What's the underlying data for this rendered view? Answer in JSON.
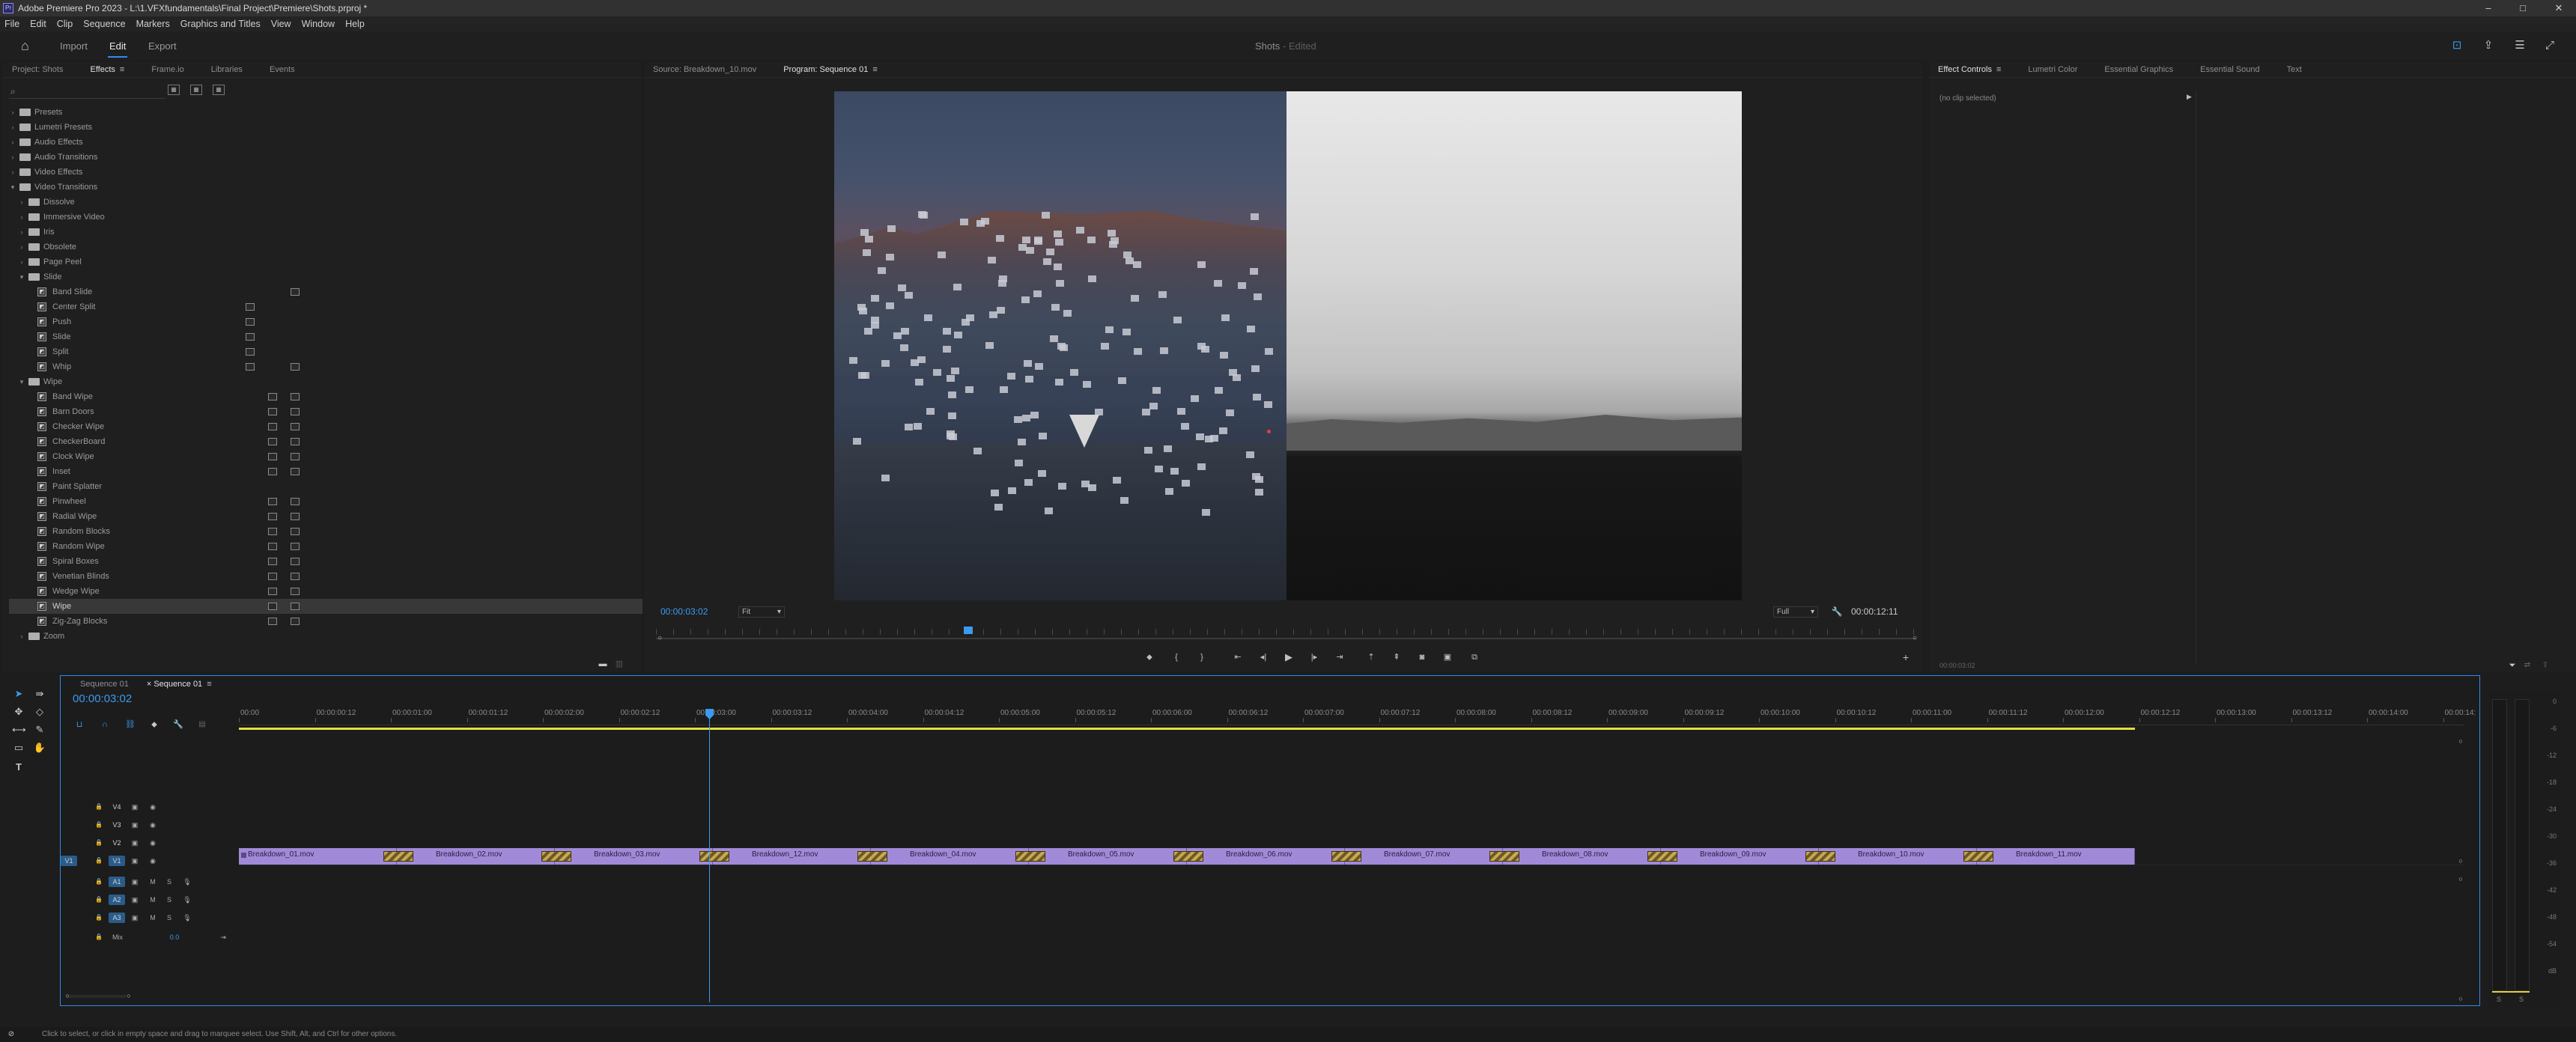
{
  "window": {
    "title": "Adobe Premiere Pro 2023 - L:\\1.VFXfundamentals\\Final Project\\Premiere\\Shots.prproj *",
    "minimize": "–",
    "maximize": "□",
    "close": "✕"
  },
  "menu": [
    "File",
    "Edit",
    "Clip",
    "Sequence",
    "Markers",
    "Graphics and Titles",
    "View",
    "Window",
    "Help"
  ],
  "workspace": {
    "tabs": [
      "Import",
      "Edit",
      "Export"
    ],
    "active_tab": "Edit",
    "project_name": "Shots",
    "project_status": "Edited",
    "icons": [
      "home-icon",
      "workspaces-icon",
      "share-icon",
      "panels-icon",
      "resize-icon"
    ]
  },
  "project_panel": {
    "tabs": [
      "Project: Shots",
      "Effects",
      "Frame.io",
      "Libraries",
      "Events"
    ],
    "active_tab": "Effects",
    "tab_menu": "≡",
    "search_icon": "⌕",
    "tree": [
      {
        "level": 0,
        "kind": "folder",
        "label": "Presets",
        "open": false
      },
      {
        "level": 0,
        "kind": "folder",
        "label": "Lumetri Presets",
        "open": false
      },
      {
        "level": 0,
        "kind": "folder",
        "label": "Audio Effects",
        "open": false
      },
      {
        "level": 0,
        "kind": "folder",
        "label": "Audio Transitions",
        "open": false
      },
      {
        "level": 0,
        "kind": "folder",
        "label": "Video Effects",
        "open": false
      },
      {
        "level": 0,
        "kind": "folder",
        "label": "Video Transitions",
        "open": true
      },
      {
        "level": 1,
        "kind": "folder",
        "label": "Dissolve",
        "open": false
      },
      {
        "level": 1,
        "kind": "folder",
        "label": "Immersive Video",
        "open": false
      },
      {
        "level": 1,
        "kind": "folder",
        "label": "Iris",
        "open": false
      },
      {
        "level": 1,
        "kind": "folder",
        "label": "Obsolete",
        "open": false
      },
      {
        "level": 1,
        "kind": "folder",
        "label": "Page Peel",
        "open": false
      },
      {
        "level": 1,
        "kind": "folder",
        "label": "Slide",
        "open": true
      },
      {
        "level": 2,
        "kind": "fx",
        "label": "Band Slide",
        "b1": false,
        "b2": true
      },
      {
        "level": 2,
        "kind": "fx",
        "label": "Center Split",
        "b1": true,
        "b2": false
      },
      {
        "level": 2,
        "kind": "fx",
        "label": "Push",
        "b1": true,
        "b2": false
      },
      {
        "level": 2,
        "kind": "fx",
        "label": "Slide",
        "b1": true,
        "b2": false
      },
      {
        "level": 2,
        "kind": "fx",
        "label": "Split",
        "b1": true,
        "b2": false
      },
      {
        "level": 2,
        "kind": "fx",
        "label": "Whip",
        "b1": true,
        "b2": true
      },
      {
        "level": 1,
        "kind": "folder",
        "label": "Wipe",
        "open": true
      },
      {
        "level": 2,
        "kind": "fx",
        "label": "Band Wipe",
        "b1": true,
        "b2": true
      },
      {
        "level": 2,
        "kind": "fx",
        "label": "Barn Doors",
        "b1": true,
        "b2": true
      },
      {
        "level": 2,
        "kind": "fx",
        "label": "Checker Wipe",
        "b1": true,
        "b2": true
      },
      {
        "level": 2,
        "kind": "fx",
        "label": "CheckerBoard",
        "b1": true,
        "b2": true
      },
      {
        "level": 2,
        "kind": "fx",
        "label": "Clock Wipe",
        "b1": true,
        "b2": true
      },
      {
        "level": 2,
        "kind": "fx",
        "label": "Inset",
        "b1": true,
        "b2": true
      },
      {
        "level": 2,
        "kind": "fx",
        "label": "Paint Splatter",
        "b1": false,
        "b2": false
      },
      {
        "level": 2,
        "kind": "fx",
        "label": "Pinwheel",
        "b1": true,
        "b2": true
      },
      {
        "level": 2,
        "kind": "fx",
        "label": "Radial Wipe",
        "b1": true,
        "b2": true
      },
      {
        "level": 2,
        "kind": "fx",
        "label": "Random Blocks",
        "b1": true,
        "b2": true
      },
      {
        "level": 2,
        "kind": "fx",
        "label": "Random Wipe",
        "b1": true,
        "b2": true
      },
      {
        "level": 2,
        "kind": "fx",
        "label": "Spiral Boxes",
        "b1": true,
        "b2": true
      },
      {
        "level": 2,
        "kind": "fx",
        "label": "Venetian Blinds",
        "b1": true,
        "b2": true
      },
      {
        "level": 2,
        "kind": "fx",
        "label": "Wedge Wipe",
        "b1": true,
        "b2": true
      },
      {
        "level": 2,
        "kind": "fx",
        "label": "Wipe",
        "b1": true,
        "b2": true,
        "selected": true
      },
      {
        "level": 2,
        "kind": "fx",
        "label": "Zig-Zag Blocks",
        "b1": true,
        "b2": true
      },
      {
        "level": 1,
        "kind": "folder",
        "label": "Zoom",
        "open": false
      }
    ]
  },
  "source_monitor_tab": "Source: Breakdown_10.mov",
  "program_monitor": {
    "tab": "Program: Sequence 01",
    "tab_menu": "≡",
    "current_time": "00:00:03:02",
    "fit": "Fit",
    "quality": "Full",
    "duration": "00:00:12:11",
    "playhead_fraction": 0.248
  },
  "effect_controls": {
    "tabs": [
      "Effect Controls",
      "Lumetri Color",
      "Essential Graphics",
      "Essential Sound",
      "Text"
    ],
    "active_tab": "Effect Controls",
    "tab_menu": "≡",
    "message": "(no clip selected)",
    "footer_time": "00:00:03:02"
  },
  "timeline": {
    "tabs": [
      "Sequence 01",
      "Sequence 01"
    ],
    "active_tab_index": 1,
    "close_mark": "×",
    "tab_menu": "≡",
    "current_time": "00:00:03:02",
    "ruler": [
      "00:00",
      "00:00:00:12",
      "00:00:01:00",
      "00:00:01:12",
      "00:00:02:00",
      "00:00:02:12",
      "00:00:03:00",
      "00:00:03:12",
      "00:00:04:00",
      "00:00:04:12",
      "00:00:05:00",
      "00:00:05:12",
      "00:00:06:00",
      "00:00:06:12",
      "00:00:07:00",
      "00:00:07:12",
      "00:00:08:00",
      "00:00:08:12",
      "00:00:09:00",
      "00:00:09:12",
      "00:00:10:00",
      "00:00:10:12",
      "00:00:11:00",
      "00:00:11:12",
      "00:00:12:00",
      "00:00:12:12",
      "00:00:13:00",
      "00:00:13:12",
      "00:00:14:00",
      "00:00:14:"
    ],
    "video_tracks": [
      "V4",
      "V3",
      "V2",
      "V1"
    ],
    "audio_tracks": [
      "A1",
      "A2",
      "A3"
    ],
    "mix_label": "Mix",
    "mix_value": "0.0",
    "clips": [
      "Breakdown_01.mov",
      "Breakdown_02.mov",
      "Breakdown_03.mov",
      "Breakdown_12.mov",
      "Breakdown_04.mov",
      "Breakdown_05.mov",
      "Breakdown_06.mov",
      "Breakdown_07.mov",
      "Breakdown_08.mov",
      "Breakdown_09.mov",
      "Breakdown_10.mov",
      "Breakdown_11.mov"
    ],
    "clip_color": "#a08ad8",
    "playhead_fraction": 0.248
  },
  "meter": {
    "labels": [
      "0",
      "-6",
      "-12",
      "-18",
      "-24",
      "-30",
      "-36",
      "-42",
      "-48",
      "-54",
      "dB"
    ],
    "channels": [
      "S",
      "S"
    ]
  },
  "status": "Click to select, or click in empty space and drag to marquee select. Use Shift, Alt, and Ctrl for other options."
}
